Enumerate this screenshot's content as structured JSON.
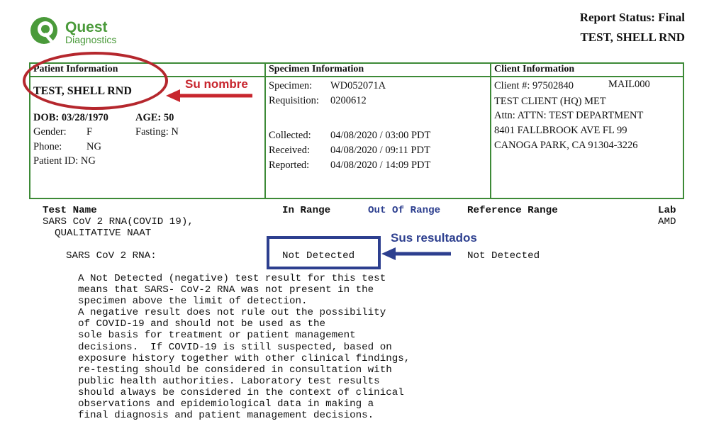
{
  "header": {
    "brand": "Quest",
    "brand_sub": "Diagnostics",
    "report_status": "Report Status: Final",
    "patient_name": "TEST, SHELL RND"
  },
  "colors": {
    "green": "#3d8a37",
    "red": "#c8262e",
    "blue": "#2d3f8f"
  },
  "patient": {
    "title": "Patient Information",
    "name": "TEST, SHELL RND",
    "dob": "DOB: 03/28/1970",
    "age": "AGE: 50",
    "gender_label": "Gender:",
    "gender_value": "F",
    "fasting": "Fasting: N",
    "phone_label": "Phone:",
    "phone_value": "NG",
    "patient_id": "Patient ID: NG"
  },
  "specimen": {
    "title": "Specimen Information",
    "specimen_label": "Specimen:",
    "specimen_value": "WD052071A",
    "requisition_label": "Requisition:",
    "requisition_value": "0200612",
    "collected_label": "Collected:",
    "collected_value": "04/08/2020 / 03:00 PDT",
    "received_label": "Received:",
    "received_value": "04/08/2020 / 09:11 PDT",
    "reported_label": "Reported:",
    "reported_value": "04/08/2020 / 14:09 PDT"
  },
  "client": {
    "title": "Client Information",
    "client_no": "Client #: 97502840",
    "mail_code": "MAIL000",
    "client_name": "TEST CLIENT (HQ) MET",
    "attn": "Attn: ATTN: TEST DEPARTMENT",
    "address1": "8401 FALLBROOK AVE FL 99",
    "address2": "CANOGA PARK, CA 91304-3226"
  },
  "annotations": {
    "name_label": "Su nombre",
    "results_label": "Sus resultados"
  },
  "results": {
    "col_test_name": "Test Name",
    "col_in_range": "In Range",
    "col_out_of_range": "Out Of Range",
    "col_reference": "Reference Range",
    "col_lab": "Lab",
    "test_line1": "SARS CoV 2 RNA(COVID 19),",
    "test_line2": "QUALITATIVE NAAT",
    "lab_code": "AMD",
    "analyte": "SARS CoV 2 RNA:",
    "result_value": "Not Detected",
    "reference_value": "Not Detected",
    "interpretation": "A Not Detected (negative) test result for this test\nmeans that SARS- CoV-2 RNA was not present in the\nspecimen above the limit of detection.\nA negative result does not rule out the possibility\nof COVID-19 and should not be used as the\nsole basis for treatment or patient management\ndecisions.  If COVID-19 is still suspected, based on\nexposure history together with other clinical findings,\nre-testing should be considered in consultation with\npublic health authorities. Laboratory test results\nshould always be considered in the context of clinical\nobservations and epidemiological data in making a\nfinal diagnosis and patient management decisions."
  }
}
